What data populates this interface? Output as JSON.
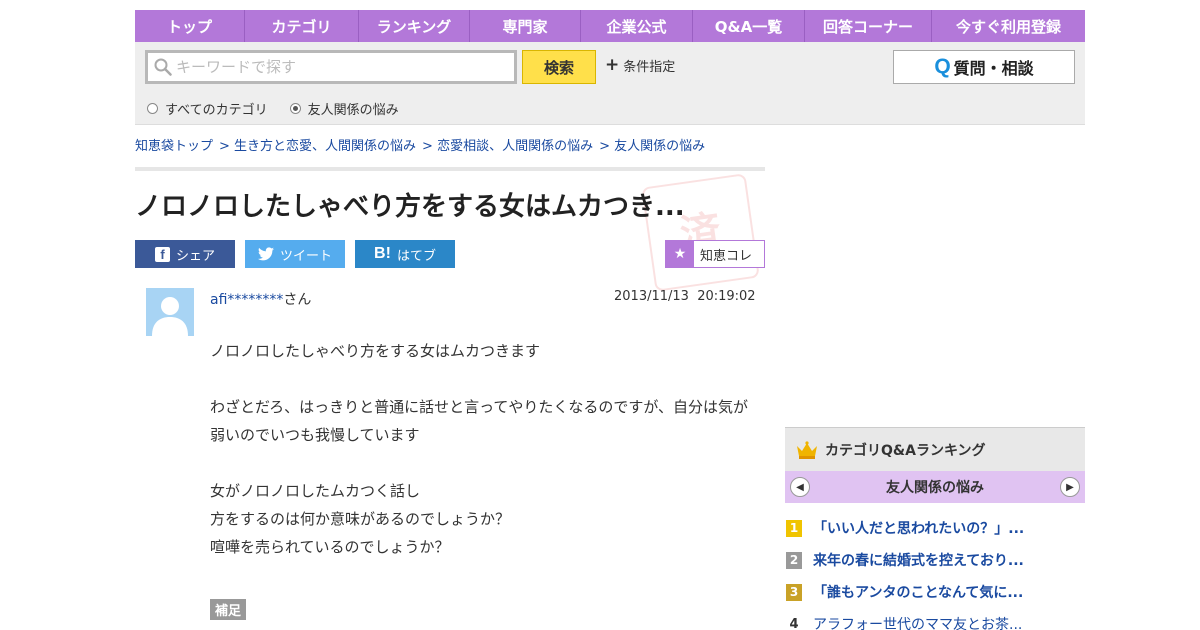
{
  "nav": {
    "items": [
      "トップ",
      "カテゴリ",
      "ランキング",
      "専門家",
      "企業公式",
      "Q&A一覧",
      "回答コーナー",
      "今すぐ利用登録"
    ]
  },
  "search": {
    "placeholder": "キーワードで探す",
    "value": "",
    "button": "検索",
    "conditions": "条件指定",
    "ask_button": "質問・相談",
    "scope_options": [
      {
        "label": "すべてのカテゴリ",
        "selected": false
      },
      {
        "label": "友人関係の悩み",
        "selected": true
      }
    ]
  },
  "breadcrumb": [
    "知恵袋トップ",
    "> 生き方と恋愛、人間関係の悩み",
    "> 恋愛相談、人間関係の悩み",
    "> 友人関係の悩み"
  ],
  "question": {
    "title": "ノロノロしたしゃべり方をする女はムカつき...",
    "share": {
      "facebook": "シェア",
      "twitter": "ツイート",
      "hatena": "はてブ"
    },
    "chiecolle": "知恵コレ",
    "user_id": "afi********",
    "user_suffix": "さん",
    "date": "2013/11/13  20:19:02",
    "body": [
      "ノロノロしたしゃべり方をする女はムカつきます",
      "",
      "わざとだろ、はっきりと普通に話せと言ってやりたくなるのですが、自分は気が弱いのでいつも我慢しています",
      "",
      "女がノロノロしたムカつく話し",
      "方をするのは何か意味があるのでしょうか？",
      "喧嘩を売られているのでしょうか？"
    ],
    "supplement_label": "補足"
  },
  "ranking": {
    "title": "カテゴリQ&Aランキング",
    "category": "友人関係の悩み",
    "items": [
      {
        "rank": "1",
        "text": "「いい人だと思われたいの？」...",
        "color": "#f0c400"
      },
      {
        "rank": "2",
        "text": "来年の春に結婚式を控えており...",
        "color": "#999999"
      },
      {
        "rank": "3",
        "text": "「誰もアンタのことなんて気に...",
        "color": "#c9a227"
      },
      {
        "rank": "4",
        "text": "アラフォー世代のママ友とお茶...",
        "color": ""
      }
    ]
  },
  "colors": {
    "nav_bg": "#b378d9",
    "link": "#1a4aa0",
    "search_button": "#ffe04a",
    "facebook": "#3b5998",
    "twitter": "#55acee",
    "hatena": "#2b87c8"
  }
}
